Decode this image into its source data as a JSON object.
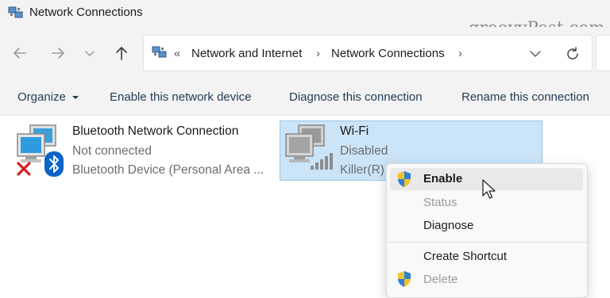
{
  "window": {
    "title": "Network Connections",
    "watermark": "groovyPost.com"
  },
  "nav": {
    "back_icon": "arrow-left-icon",
    "forward_icon": "arrow-right-icon",
    "recent_icon": "chevron-down-icon",
    "up_icon": "arrow-up-icon",
    "breadcrumb": {
      "overflow": "«",
      "items": [
        "Network and Internet",
        "Network Connections"
      ],
      "separator": "›"
    }
  },
  "commands": {
    "organize": "Organize",
    "enable_device": "Enable this network device",
    "diagnose": "Diagnose this connection",
    "rename": "Rename this connection"
  },
  "connections": [
    {
      "name": "Bluetooth Network Connection",
      "status": "Not connected",
      "device": "Bluetooth Device (Personal Area ..."
    },
    {
      "name": "Wi-Fi",
      "status": "Disabled",
      "device": "Killer(R) W"
    }
  ],
  "context_menu": {
    "enable": "Enable",
    "status": "Status",
    "diagnose": "Diagnose",
    "create_shortcut": "Create Shortcut",
    "delete": "Delete"
  },
  "colors": {
    "selection_bg": "#cce4f7",
    "selection_border": "#99c9ef",
    "bluetooth_blue": "#0a64c9",
    "error_red": "#d11f1f"
  }
}
